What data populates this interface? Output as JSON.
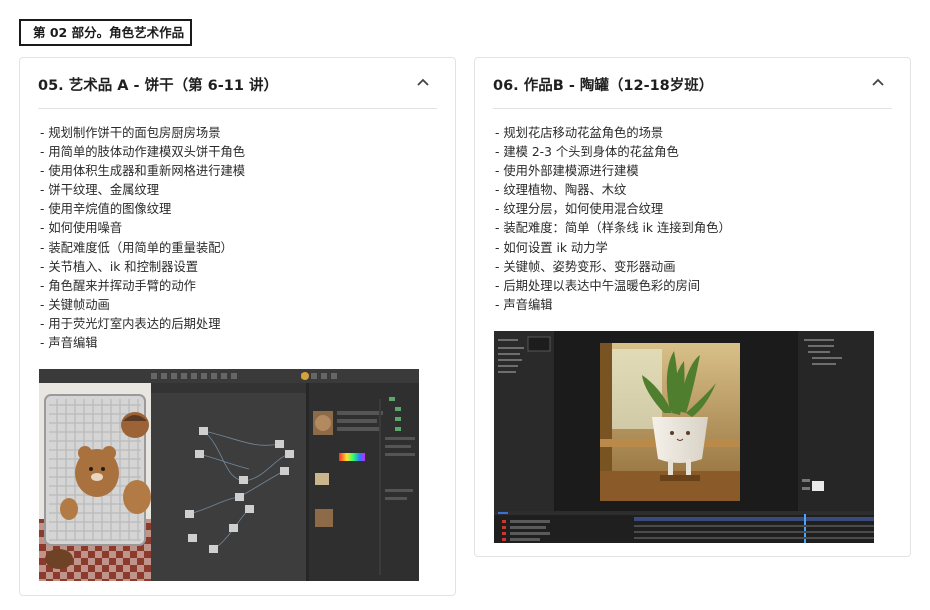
{
  "section": {
    "label": "第 02 部分。角色艺术作品"
  },
  "cards": [
    {
      "title": "05. 艺术品 A - 饼干（第 6-11 讲）",
      "items": [
        "- 规划制作饼干的面包房厨房场景",
        "- 用简单的肢体动作建模双头饼干角色",
        "- 使用体积生成器和重新网格进行建模",
        "- 饼干纹理、金属纹理",
        "- 使用辛烷值的图像纹理",
        "- 如何使用噪音",
        "- 装配难度低（用简单的重量装配）",
        "- 关节植入、ik 和控制器设置",
        "- 角色醒来并挥动手臂的动作",
        "- 关键帧动画",
        "- 用于荧光灯室内表达的后期处理",
        "- 声音编辑"
      ],
      "preview_icon": "node-editor-screenshot"
    },
    {
      "title": "06. 作品B - 陶罐（12-18岁班）",
      "items": [
        "- 规划花店移动花盆角色的场景",
        "- 建模 2-3 个头到身体的花盆角色",
        "- 使用外部建模源进行建模",
        "- 纹理植物、陶器、木纹",
        "- 纹理分层，如何使用混合纹理",
        "- 装配难度：简单（样条线 ik 连接到角色）",
        "- 如何设置 ik 动力学",
        "- 关键帧、姿势变形、变形器动画",
        "- 后期处理以表达中午温暖色彩的房间",
        "- 声音编辑"
      ],
      "preview_icon": "after-effects-screenshot"
    }
  ],
  "colors": {
    "accent_border": "#1a1a1a",
    "card_border": "#e3e3e3",
    "app_dark": "#2b2b2b"
  },
  "icons": {
    "collapse": "chevron-up-icon"
  }
}
